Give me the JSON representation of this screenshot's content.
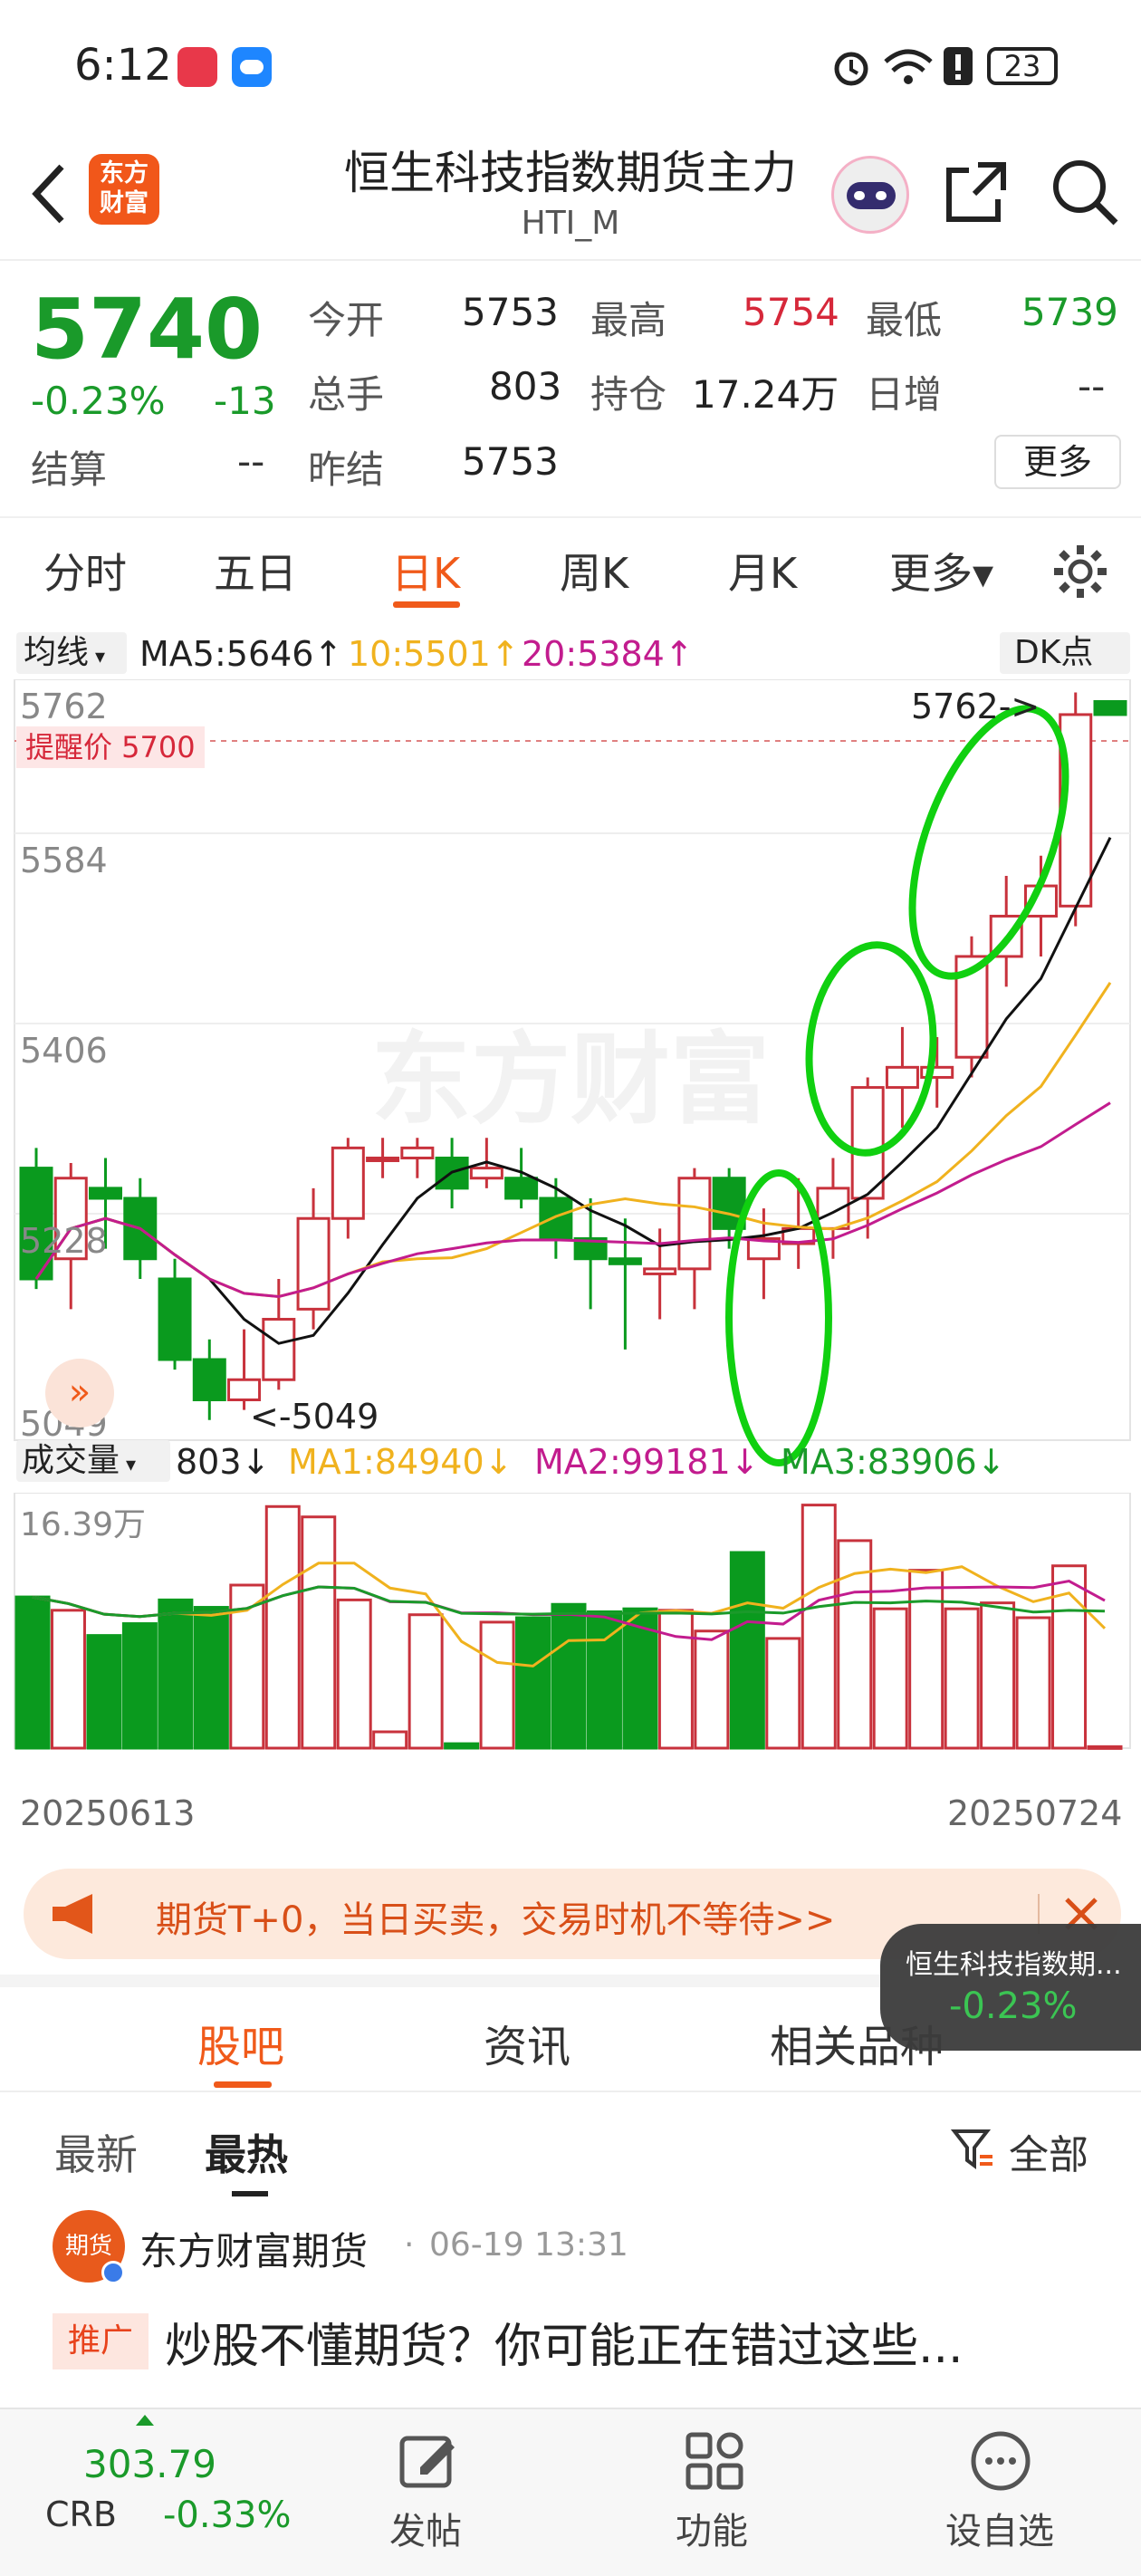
{
  "status": {
    "time": "6:12",
    "battery": "23"
  },
  "header": {
    "logo_line1": "东方",
    "logo_line2": "财富",
    "title": "恒生科技指数期货主力",
    "code": "HTI_M"
  },
  "quote": {
    "price": "5740",
    "change_pct": "-0.23%",
    "change": "-13",
    "open_label": "今开",
    "open": "5753",
    "high_label": "最高",
    "high": "5754",
    "low_label": "最低",
    "low": "5739",
    "vol_label": "总手",
    "vol": "803",
    "oi_label": "持仓",
    "oi": "17.24万",
    "daily_label": "日增",
    "daily": "--",
    "settle_label": "结算",
    "settle": "--",
    "prev_label": "昨结",
    "prev": "5753",
    "more": "更多"
  },
  "tabs": [
    "分时",
    "五日",
    "日K",
    "周K",
    "月K",
    "更多▾"
  ],
  "active_tab": 2,
  "chart": {
    "ma_select": "均线",
    "ma5": "MA5:5646↑",
    "ma10": "10:5501↑",
    "ma20": "20:5384↑",
    "dk": "DK点",
    "alert": "提醒价 5700",
    "hi_mark": "5762->",
    "lo_mark": "<-5049",
    "vol_select": "成交量",
    "vol_val": "803↓",
    "vma1": "MA1:84940↓",
    "vma2": "MA2:99181↓",
    "vma3": "MA3:83906↓",
    "vol_top": "16.39万",
    "date_start": "20250613",
    "date_end": "20250724",
    "watermark": "东方财富"
  },
  "chart_data": {
    "type": "candlestick",
    "y_ticks": [
      5762,
      5584,
      5406,
      5228,
      5049
    ],
    "ylim": [
      5049,
      5762
    ],
    "alert_price": 5700,
    "candles": [
      [
        5290,
        5180,
        5310,
        5170
      ],
      [
        5200,
        5280,
        5295,
        5150
      ],
      [
        5270,
        5260,
        5300,
        5210
      ],
      [
        5260,
        5200,
        5280,
        5180
      ],
      [
        5180,
        5100,
        5200,
        5090
      ],
      [
        5100,
        5060,
        5120,
        5040
      ],
      [
        5060,
        5080,
        5130,
        5050
      ],
      [
        5080,
        5140,
        5180,
        5070
      ],
      [
        5150,
        5240,
        5270,
        5130
      ],
      [
        5240,
        5310,
        5320,
        5220
      ],
      [
        5300,
        5300,
        5320,
        5280
      ],
      [
        5300,
        5310,
        5320,
        5280
      ],
      [
        5300,
        5270,
        5320,
        5250
      ],
      [
        5280,
        5290,
        5320,
        5270
      ],
      [
        5280,
        5260,
        5310,
        5250
      ],
      [
        5260,
        5220,
        5280,
        5200
      ],
      [
        5220,
        5200,
        5260,
        5150
      ],
      [
        5200,
        5195,
        5240,
        5110
      ],
      [
        5185,
        5190,
        5230,
        5140
      ],
      [
        5190,
        5280,
        5290,
        5150
      ],
      [
        5280,
        5230,
        5290,
        5210
      ],
      [
        5200,
        5220,
        5250,
        5160
      ],
      [
        5215,
        5230,
        5280,
        5190
      ],
      [
        5230,
        5270,
        5300,
        5200
      ],
      [
        5260,
        5370,
        5380,
        5220
      ],
      [
        5370,
        5390,
        5430,
        5330
      ],
      [
        5380,
        5390,
        5420,
        5350
      ],
      [
        5400,
        5500,
        5520,
        5380
      ],
      [
        5500,
        5540,
        5580,
        5470
      ],
      [
        5540,
        5570,
        5600,
        5500
      ],
      [
        5550,
        5740,
        5762,
        5530
      ],
      [
        5753,
        5740,
        5754,
        5739
      ]
    ],
    "volume_max": "16.39万",
    "volume": [
      10.2,
      9.3,
      7.6,
      8.4,
      10,
      9.5,
      11,
      16.3,
      15.6,
      10,
      1.1,
      9,
      0.3,
      8.5,
      8.8,
      9.7,
      9.2,
      9.4,
      9.3,
      7.9,
      13.2,
      7.4,
      16.4,
      14,
      9.4,
      12,
      9.4,
      9.8,
      8.8,
      12.3,
      0.1
    ]
  },
  "banner": {
    "text": "期货T+0，当日买卖，交易时机不等待>>"
  },
  "float": {
    "name": "恒生科技指数期...",
    "pct": "-0.23%"
  },
  "lowertabs": [
    "股吧",
    "资讯",
    "相关品种"
  ],
  "subtabs": {
    "latest": "最新",
    "hot": "最热",
    "all": "全部"
  },
  "post": {
    "author": "东方财富期货",
    "time": "06-19 13:31",
    "tag": "推广",
    "title": "炒股不懂期货？你可能正在错过这些..."
  },
  "navbar": {
    "crb": "CRB",
    "crb_val": "303.79",
    "crb_pct": "-0.33%",
    "post": "发帖",
    "func": "功能",
    "fav": "设自选"
  }
}
